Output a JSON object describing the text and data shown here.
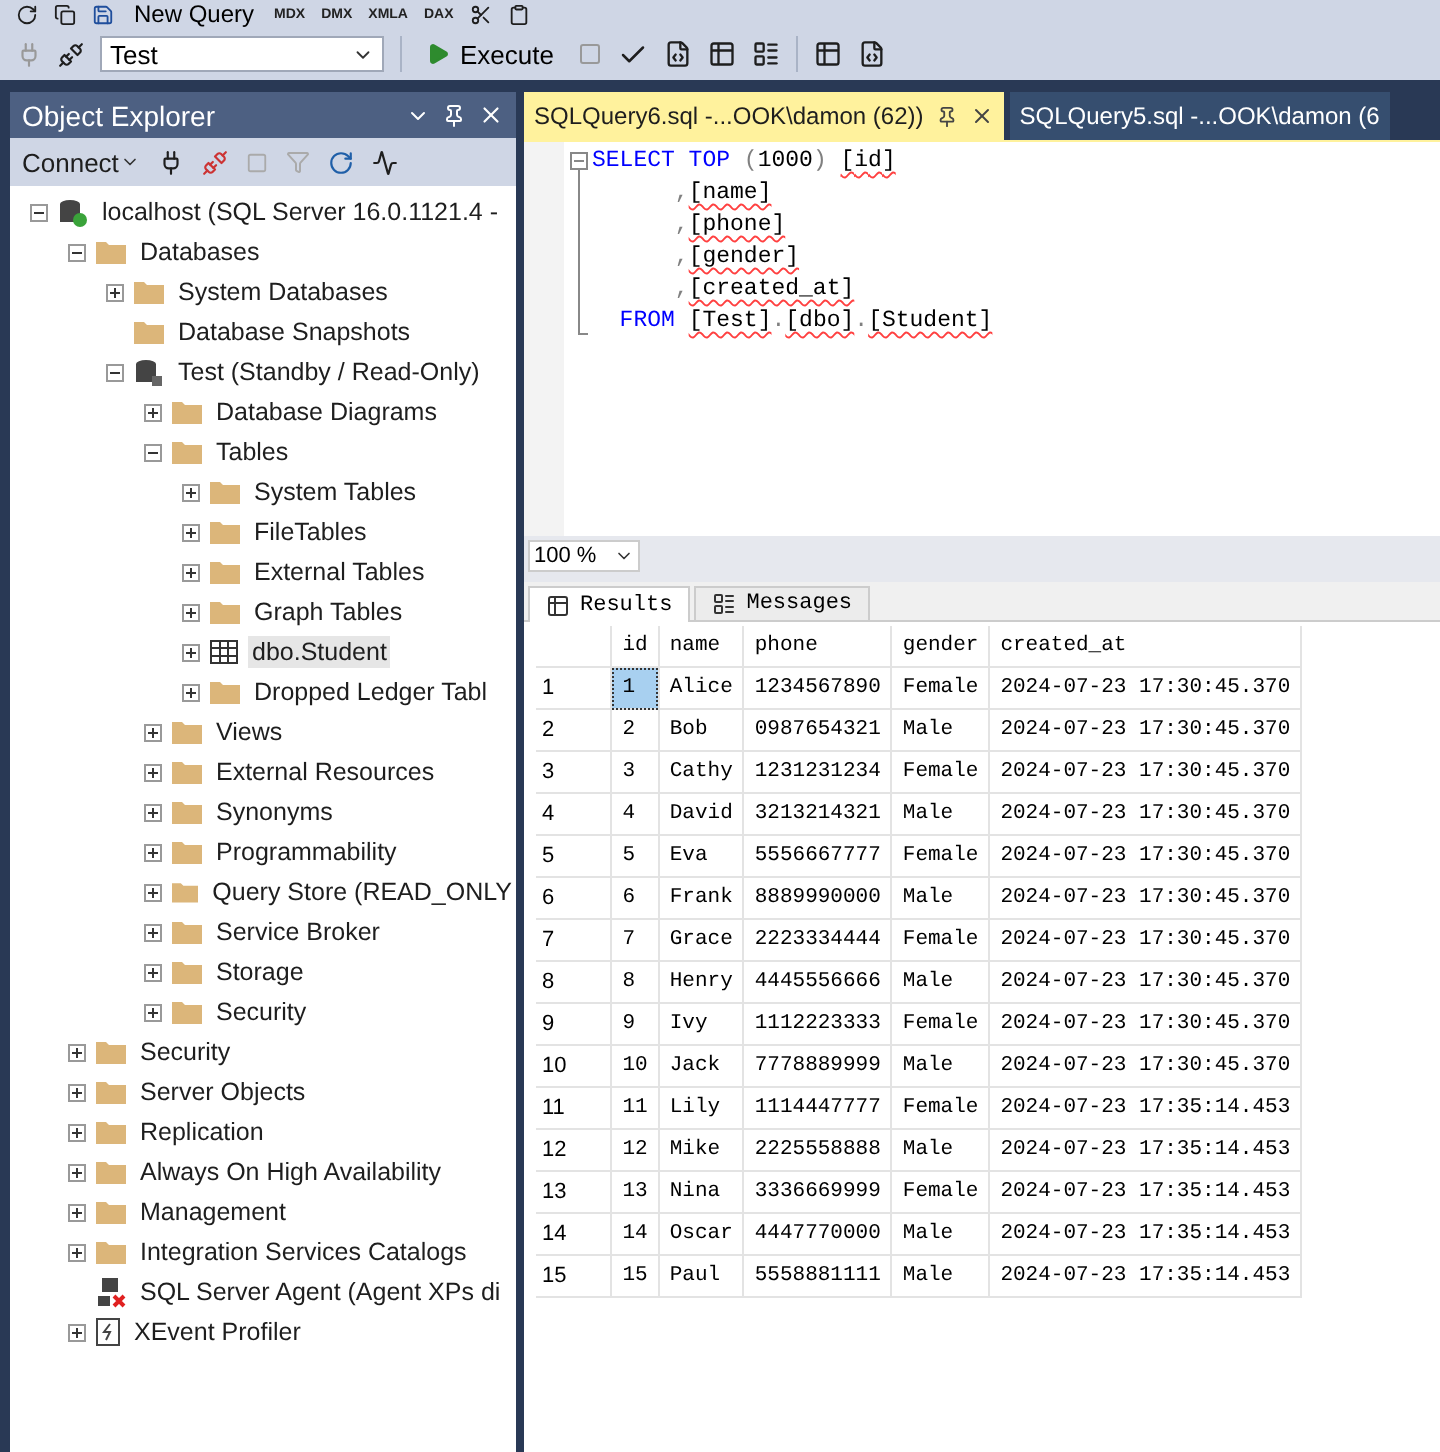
{
  "toolbar_top": {
    "new_query": "New Query",
    "query_types": [
      "MDX",
      "DMX",
      "XMLA",
      "DAX"
    ]
  },
  "toolbar": {
    "database": "Test",
    "execute": "Execute"
  },
  "object_explorer": {
    "title": "Object Explorer",
    "connect": "Connect",
    "tree": [
      {
        "label": "localhost (SQL Server 16.0.1121.4 -",
        "kind": "server",
        "expanded": true,
        "selected": false,
        "children": [
          {
            "label": "Databases",
            "kind": "folder",
            "expanded": true,
            "selected": false,
            "children": [
              {
                "label": "System Databases",
                "kind": "folder",
                "expanded": false,
                "selected": false
              },
              {
                "label": "Database Snapshots",
                "kind": "folder",
                "selected": false
              },
              {
                "label": "Test (Standby / Read-Only)",
                "kind": "database",
                "expanded": true,
                "selected": false,
                "children": [
                  {
                    "label": "Database Diagrams",
                    "kind": "folder",
                    "expanded": false,
                    "selected": false
                  },
                  {
                    "label": "Tables",
                    "kind": "folder",
                    "expanded": true,
                    "selected": false,
                    "children": [
                      {
                        "label": "System Tables",
                        "kind": "folder",
                        "expanded": false,
                        "selected": false
                      },
                      {
                        "label": "FileTables",
                        "kind": "folder",
                        "expanded": false,
                        "selected": false
                      },
                      {
                        "label": "External Tables",
                        "kind": "folder",
                        "expanded": false,
                        "selected": false
                      },
                      {
                        "label": "Graph Tables",
                        "kind": "folder",
                        "expanded": false,
                        "selected": false
                      },
                      {
                        "label": "dbo.Student",
                        "kind": "table",
                        "expanded": false,
                        "selected": true
                      },
                      {
                        "label": "Dropped Ledger Tabl",
                        "kind": "folder",
                        "expanded": false,
                        "selected": false
                      }
                    ]
                  },
                  {
                    "label": "Views",
                    "kind": "folder",
                    "expanded": false,
                    "selected": false
                  },
                  {
                    "label": "External Resources",
                    "kind": "folder",
                    "expanded": false,
                    "selected": false
                  },
                  {
                    "label": "Synonyms",
                    "kind": "folder",
                    "expanded": false,
                    "selected": false
                  },
                  {
                    "label": "Programmability",
                    "kind": "folder",
                    "expanded": false,
                    "selected": false
                  },
                  {
                    "label": "Query Store (READ_ONLY",
                    "kind": "folder",
                    "expanded": false,
                    "selected": false
                  },
                  {
                    "label": "Service Broker",
                    "kind": "folder",
                    "expanded": false,
                    "selected": false
                  },
                  {
                    "label": "Storage",
                    "kind": "folder",
                    "expanded": false,
                    "selected": false
                  },
                  {
                    "label": "Security",
                    "kind": "folder",
                    "expanded": false,
                    "selected": false
                  }
                ]
              }
            ]
          },
          {
            "label": "Security",
            "kind": "folder",
            "expanded": false,
            "selected": false
          },
          {
            "label": "Server Objects",
            "kind": "folder",
            "expanded": false,
            "selected": false
          },
          {
            "label": "Replication",
            "kind": "folder",
            "expanded": false,
            "selected": false
          },
          {
            "label": "Always On High Availability",
            "kind": "folder",
            "expanded": false,
            "selected": false
          },
          {
            "label": "Management",
            "kind": "folder",
            "expanded": false,
            "selected": false
          },
          {
            "label": "Integration Services Catalogs",
            "kind": "folder",
            "expanded": false,
            "selected": false
          },
          {
            "label": "SQL Server Agent (Agent XPs di",
            "kind": "agent",
            "selected": false
          },
          {
            "label": "XEvent Profiler",
            "kind": "profiler",
            "expanded": false,
            "selected": false
          }
        ]
      }
    ]
  },
  "document_tabs": [
    {
      "label": "SQLQuery6.sql -...OOK\\damon (62))",
      "selected": true
    },
    {
      "label": "SQLQuery5.sql -...OOK\\damon (6",
      "selected": false
    }
  ],
  "editor": {
    "lines": [
      {
        "tokens": [
          {
            "text": "SELECT TOP ",
            "kind": "keyword"
          },
          {
            "text": "(",
            "kind": "punct"
          },
          {
            "text": "1000",
            "kind": "plain"
          },
          {
            "text": ") ",
            "kind": "punct"
          },
          {
            "text": "[id]",
            "kind": "ident"
          }
        ]
      },
      {
        "tokens": [
          {
            "text": "      ,",
            "kind": "punct"
          },
          {
            "text": "[name]",
            "kind": "ident"
          }
        ]
      },
      {
        "tokens": [
          {
            "text": "      ,",
            "kind": "punct"
          },
          {
            "text": "[phone]",
            "kind": "ident"
          }
        ]
      },
      {
        "tokens": [
          {
            "text": "      ,",
            "kind": "punct"
          },
          {
            "text": "[gender]",
            "kind": "ident"
          }
        ]
      },
      {
        "tokens": [
          {
            "text": "      ,",
            "kind": "punct"
          },
          {
            "text": "[created_at]",
            "kind": "ident"
          }
        ]
      },
      {
        "tokens": [
          {
            "text": "  FROM ",
            "kind": "keyword"
          },
          {
            "text": "[Test]",
            "kind": "ident"
          },
          {
            "text": ".",
            "kind": "punct"
          },
          {
            "text": "[dbo]",
            "kind": "ident"
          },
          {
            "text": ".",
            "kind": "punct"
          },
          {
            "text": "[Student]",
            "kind": "ident"
          }
        ]
      }
    ]
  },
  "zoom": "100 %",
  "result_tabs": [
    {
      "label": "Results",
      "selected": true
    },
    {
      "label": "Messages",
      "selected": false
    }
  ],
  "results": {
    "columns": [
      "id",
      "name",
      "phone",
      "gender",
      "created_at"
    ],
    "rows": [
      {
        "number": "1",
        "focused": true,
        "cells": [
          "1",
          "Alice",
          "1234567890",
          "Female",
          "2024-07-23 17:30:45.370"
        ]
      },
      {
        "number": "2",
        "focused": false,
        "cells": [
          "2",
          "Bob",
          "0987654321",
          "Male",
          "2024-07-23 17:30:45.370"
        ]
      },
      {
        "number": "3",
        "focused": false,
        "cells": [
          "3",
          "Cathy",
          "1231231234",
          "Female",
          "2024-07-23 17:30:45.370"
        ]
      },
      {
        "number": "4",
        "focused": false,
        "cells": [
          "4",
          "David",
          "3213214321",
          "Male",
          "2024-07-23 17:30:45.370"
        ]
      },
      {
        "number": "5",
        "focused": false,
        "cells": [
          "5",
          "Eva",
          "5556667777",
          "Female",
          "2024-07-23 17:30:45.370"
        ]
      },
      {
        "number": "6",
        "focused": false,
        "cells": [
          "6",
          "Frank",
          "8889990000",
          "Male",
          "2024-07-23 17:30:45.370"
        ]
      },
      {
        "number": "7",
        "focused": false,
        "cells": [
          "7",
          "Grace",
          "2223334444",
          "Female",
          "2024-07-23 17:30:45.370"
        ]
      },
      {
        "number": "8",
        "focused": false,
        "cells": [
          "8",
          "Henry",
          "4445556666",
          "Male",
          "2024-07-23 17:30:45.370"
        ]
      },
      {
        "number": "9",
        "focused": false,
        "cells": [
          "9",
          "Ivy",
          "1112223333",
          "Female",
          "2024-07-23 17:30:45.370"
        ]
      },
      {
        "number": "10",
        "focused": false,
        "cells": [
          "10",
          "Jack",
          "7778889999",
          "Male",
          "2024-07-23 17:30:45.370"
        ]
      },
      {
        "number": "11",
        "focused": false,
        "cells": [
          "11",
          "Lily",
          "1114447777",
          "Female",
          "2024-07-23 17:35:14.453"
        ]
      },
      {
        "number": "12",
        "focused": false,
        "cells": [
          "12",
          "Mike",
          "2225558888",
          "Male",
          "2024-07-23 17:35:14.453"
        ]
      },
      {
        "number": "13",
        "focused": false,
        "cells": [
          "13",
          "Nina",
          "3336669999",
          "Female",
          "2024-07-23 17:35:14.453"
        ]
      },
      {
        "number": "14",
        "focused": false,
        "cells": [
          "14",
          "Oscar",
          "4447770000",
          "Male",
          "2024-07-23 17:35:14.453"
        ]
      },
      {
        "number": "15",
        "focused": false,
        "cells": [
          "15",
          "Paul",
          "5558881111",
          "Male",
          "2024-07-23 17:35:14.453"
        ]
      }
    ]
  }
}
